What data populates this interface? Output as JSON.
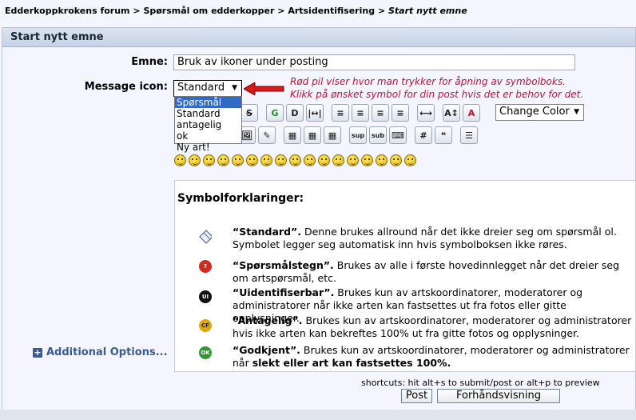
{
  "breadcrumb": {
    "items": [
      "Edderkoppkrokens forum",
      "Spørsmål om edderkopper",
      "Artsidentifisering"
    ],
    "sep": ">",
    "current": "Start nytt emne"
  },
  "panel": {
    "title": "Start nytt emne"
  },
  "form": {
    "subject_label": "Emne:",
    "subject_value": "Bruk av ikoner under posting",
    "icon_label": "Message icon:",
    "icon_selected": "Standard",
    "icon_options": [
      "Spørsmål",
      "Standard",
      "antagelig",
      "ok",
      "Ny art!"
    ],
    "highlighted_option": "Spørsmål"
  },
  "annotation": {
    "line1": "Rød pil viser hvor man trykker for åpning av symbolboks.",
    "line2": "Klikk på ønsket symbol for din post hvis det er behov for det.",
    "color": "#c8102e"
  },
  "toolbar": {
    "row1": [
      "strike-icon",
      "glow-icon",
      "shadow-icon",
      "marquee-icon",
      "align-left-icon",
      "align-center-icon",
      "align-right-icon",
      "justify-icon",
      "hr-icon",
      "font-size-icon",
      "font-color-icon"
    ],
    "change_color": "Change Color",
    "row2": [
      "image-icon",
      "insert-icon",
      "table-icon",
      "table-row-icon",
      "table-cell-icon",
      "sup-icon",
      "sub-icon",
      "teletype-icon",
      "code-icon",
      "quote-icon",
      "list-icon"
    ],
    "sup": "sup",
    "sub": "sub"
  },
  "smileys": {
    "count": 15
  },
  "legend": {
    "title": "Symbolforklaringer:",
    "entries": [
      {
        "name": "“Standard”.",
        "desc": " Denne brukes allround når det ikke dreier seg om spørsmål ol. Symbolet legger seg automatisk inn hvis symbolboksen ikke røres.",
        "icon": "standard-icon",
        "badge": "",
        "color": "#7a8fb8"
      },
      {
        "name": "“Spørsmålstegn”.",
        "desc": " Brukes av alle i første hovedinnlegget når det dreier seg om artspørsmål, etc.",
        "icon": "question-icon",
        "badge": "?",
        "color": "#d12b1e"
      },
      {
        "name": "“Uidentifiserbar”.",
        "desc": " Brukes kun av artskoordinatorer, moderatorer og administratorer når ikke arten kan fastsettes ut fra fotos eller gitte opplysninger.",
        "icon": "unidentified-icon",
        "badge": "UI",
        "color": "#111111"
      },
      {
        "name": "“Antagelig”.",
        "desc": " Brukes kun av artskoordinatorer, moderatorer og administratorer hvis ikke arten kan bekreftes 100% ut fra gitte fotos og opplysninger.",
        "icon": "probable-icon",
        "badge": "CF",
        "color": "#e0a800"
      },
      {
        "name": "“Godkjent”.",
        "desc": " Brukes kun av artskoordinatorer, moderatorer og administratorer når ",
        "desc_bold": "slekt eller art kan fastsettes 100%.",
        "icon": "approved-icon",
        "badge": "OK",
        "color": "#2c9a2c"
      }
    ]
  },
  "additional_options": "Additional Options...",
  "shortcuts": "shortcuts: hit alt+s to submit/post or alt+p to preview",
  "buttons": {
    "post": "Post",
    "preview": "Forhåndsvisning"
  }
}
